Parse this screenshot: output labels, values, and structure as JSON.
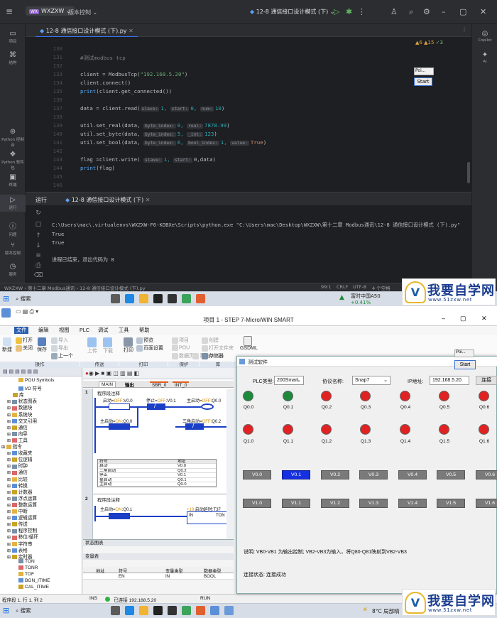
{
  "ide": {
    "project": "WXZXW",
    "project_badge": "WX",
    "version_control": "版本控制",
    "run_config": "12-8 通信接口设计模式 (下)",
    "left_tools": [
      "项目",
      "结构",
      "Python 控制台",
      "Python 软件包",
      "终端",
      "运行",
      "问题",
      "版本控制",
      "服务"
    ],
    "right_tools": [
      "Copilot",
      "AI"
    ],
    "file_tab": "12-8 通信接口设计模式 (下).py",
    "inspections": {
      "warnings": "6",
      "weak": "15",
      "typos": "3"
    },
    "code_lines": [
      {
        "n": "130",
        "parts": []
      },
      {
        "n": "131",
        "parts": [
          {
            "t": "#测试modbus tcp",
            "c": "cm"
          }
        ]
      },
      {
        "n": "132",
        "parts": []
      },
      {
        "n": "133",
        "parts": [
          {
            "t": "client = ModbusTcp(",
            "c": ""
          },
          {
            "t": "\"192.168.5.20\"",
            "c": "str"
          },
          {
            "t": ")",
            "c": ""
          }
        ]
      },
      {
        "n": "134",
        "parts": [
          {
            "t": "client.connect()",
            "c": ""
          }
        ]
      },
      {
        "n": "135",
        "parts": [
          {
            "t": "print",
            "c": "fn"
          },
          {
            "t": "(client.get_connected())",
            "c": ""
          }
        ]
      },
      {
        "n": "136",
        "parts": []
      },
      {
        "n": "137",
        "parts": [
          {
            "t": "data = client.read(",
            "c": ""
          },
          {
            "t": "slave:",
            "c": "hint"
          },
          {
            "t": "1, ",
            "c": "num"
          },
          {
            "t": "start:",
            "c": "hint"
          },
          {
            "t": "0, ",
            "c": "num"
          },
          {
            "t": "num:",
            "c": "hint"
          },
          {
            "t": "10",
            "c": "num"
          },
          {
            "t": ")",
            "c": ""
          }
        ]
      },
      {
        "n": "138",
        "parts": []
      },
      {
        "n": "139",
        "parts": [
          {
            "t": "util.set_real(data, ",
            "c": ""
          },
          {
            "t": "byte_index:",
            "c": "hint"
          },
          {
            "t": "0, ",
            "c": "num"
          },
          {
            "t": "real:",
            "c": "hint"
          },
          {
            "t": "7878.99",
            "c": "num"
          },
          {
            "t": ")",
            "c": ""
          }
        ]
      },
      {
        "n": "140",
        "parts": [
          {
            "t": "util.set_byte(data, ",
            "c": ""
          },
          {
            "t": "byte_index:",
            "c": "hint"
          },
          {
            "t": "5, ",
            "c": "num"
          },
          {
            "t": "_int:",
            "c": "hint"
          },
          {
            "t": "123",
            "c": "num"
          },
          {
            "t": ")",
            "c": ""
          }
        ]
      },
      {
        "n": "141",
        "parts": [
          {
            "t": "util.set_bool(data, ",
            "c": ""
          },
          {
            "t": "byte_index:",
            "c": "hint"
          },
          {
            "t": "6, ",
            "c": "num"
          },
          {
            "t": "bool_index:",
            "c": "hint"
          },
          {
            "t": "1, ",
            "c": "num"
          },
          {
            "t": "value:",
            "c": "hint"
          },
          {
            "t": "True",
            "c": "kw"
          },
          {
            "t": ")",
            "c": ""
          }
        ]
      },
      {
        "n": "142",
        "parts": []
      },
      {
        "n": "143",
        "parts": [
          {
            "t": "flag =client.write( ",
            "c": ""
          },
          {
            "t": "slave:",
            "c": "hint"
          },
          {
            "t": "1, ",
            "c": "num"
          },
          {
            "t": "start:",
            "c": "hint"
          },
          {
            "t": "0,data)",
            "c": ""
          }
        ]
      },
      {
        "n": "144",
        "parts": [
          {
            "t": "print",
            "c": "fn"
          },
          {
            "t": "(flag)",
            "c": ""
          }
        ]
      },
      {
        "n": "145",
        "parts": []
      },
      {
        "n": "146",
        "parts": []
      },
      {
        "n": "147",
        "parts": []
      }
    ],
    "run_label": "运行",
    "run_tab": "12-8 通信接口设计模式 (下)",
    "console": [
      "C:\\Users\\mac\\.virtualenvs\\WXZXW-F6-KOBXe\\Scripts\\python.exe \"C:\\Users\\mac\\Desktop\\WXZXW\\第十二章 Modbus通讯\\12-8 通信接口设计模式 (下).py\"",
      "True",
      "True",
      "",
      "进程已结束，退出代码为 0"
    ],
    "mini_window": "Poi...",
    "start_button": "Start",
    "breadcrumb": [
      "WXZXW",
      "第十二章 Modbus通讯",
      "12-8 通信接口设计模式 (下).py"
    ],
    "status_right": [
      "99:1",
      "CRLF",
      "UTF-8",
      "4 个空格"
    ]
  },
  "taskbar_top": {
    "search": "搜索",
    "tray": "富时中国A50",
    "tray_sub": "+0.41%"
  },
  "watermark": {
    "title": "我要自学网",
    "url": "www.51zxw.net"
  },
  "step7": {
    "title": "项目 1 - STEP 7-Micro/WIN SMART",
    "menus": [
      "文件",
      "编辑",
      "视图",
      "PLC",
      "调试",
      "工具",
      "帮助"
    ],
    "ribbon": {
      "new": "新建",
      "open": "打开",
      "close": "关闭",
      "save": "保存",
      "import": "导入",
      "export": "导出",
      "prev": "上一个",
      "upload": "上传",
      "download": "下载",
      "print": "打印",
      "preview": "预览",
      "page_setup": "页面设置",
      "project": "项目",
      "pou": "POU",
      "data_page": "数据页",
      "system_block": "系统块",
      "create": "创建",
      "open_folder": "打开文件夹",
      "memory_card": "存储器",
      "gsdml": "GSDML",
      "sections": [
        "操作",
        "传送",
        "打印",
        "保护",
        "库"
      ]
    },
    "tree": [
      {
        "t": "POU Symbols",
        "lv": 2
      },
      {
        "t": "I/O 符号",
        "lv": 2
      },
      {
        "t": "库",
        "lv": 1
      },
      {
        "t": "状态图表",
        "lv": 0
      },
      {
        "t": "数据块",
        "lv": 0
      },
      {
        "t": "系统块",
        "lv": 0
      },
      {
        "t": "交叉引用",
        "lv": 0
      },
      {
        "t": "通信",
        "lv": 0
      },
      {
        "t": "向导",
        "lv": 0
      },
      {
        "t": "工具",
        "lv": 0
      },
      {
        "t": "指令",
        "lv": -1
      },
      {
        "t": "收藏夹",
        "lv": 0
      },
      {
        "t": "位逻辑",
        "lv": 0
      },
      {
        "t": "时钟",
        "lv": 0
      },
      {
        "t": "通信",
        "lv": 0
      },
      {
        "t": "比较",
        "lv": 0
      },
      {
        "t": "转换",
        "lv": 0
      },
      {
        "t": "计数器",
        "lv": 0
      },
      {
        "t": "浮点运算",
        "lv": 0
      },
      {
        "t": "整数运算",
        "lv": 0
      },
      {
        "t": "中断",
        "lv": 0
      },
      {
        "t": "逻辑运算",
        "lv": 0
      },
      {
        "t": "传送",
        "lv": 0
      },
      {
        "t": "程序控制",
        "lv": 0
      },
      {
        "t": "移位/循环",
        "lv": 0
      },
      {
        "t": "字符串",
        "lv": 0
      },
      {
        "t": "表格",
        "lv": 0
      },
      {
        "t": "定时器",
        "lv": 0
      },
      {
        "t": "TON",
        "lv": 2
      },
      {
        "t": "TONR",
        "lv": 2
      },
      {
        "t": "TOF",
        "lv": 2
      },
      {
        "t": "BGN_ITIME",
        "lv": 2
      },
      {
        "t": "CAL_ITIME",
        "lv": 2
      }
    ],
    "prog_tabs": [
      "MAIN",
      "SBR_0",
      "INT_0"
    ],
    "seg1_title": "程序段注释",
    "seg1_num": "1",
    "seg2_num": "2",
    "seg2_title": "程序段注释",
    "rung": {
      "start": "启动",
      "start_state": "OFF",
      "start_addr": "V0.0",
      "stop": "停止",
      "stop_state": "OFF",
      "stop_addr": "V0.1",
      "main_start": "主启动",
      "main_start_state": "ON",
      "main_start_addr": "Q0.0",
      "tri_start": "三角启动",
      "tri_start_state": "OFF",
      "tri_start_addr": "Q0.2",
      "coil_out": "主启动",
      "coil_state": "OFF",
      "coil_addr": "Q0.0",
      "seg2_contact": "主启动",
      "seg2_state": "ON",
      "seg2_addr": "Q0.1",
      "timer_pre": "+19",
      "timer_name": "启动延时",
      "timer_addr": "T37",
      "timer_in": "IN",
      "timer_type": "TON"
    },
    "symbol_table": {
      "headers": [
        "符号",
        "地址"
      ],
      "rows": [
        [
          "启动",
          "V0.0"
        ],
        [
          "三角启动",
          "Q0.2"
        ],
        [
          "停止",
          "V0.1"
        ],
        [
          "星启动",
          "Q0.1"
        ],
        [
          "主启动",
          "Q0.0"
        ]
      ]
    },
    "state_table": "状态图表",
    "var_table": "变量表",
    "var_headers": [
      "地址",
      "符号",
      "变量类型",
      "数据类型",
      "注释"
    ],
    "var_row": [
      "",
      "EN",
      "IN",
      "BOOL",
      ""
    ],
    "status": {
      "pos": "程序段 1, 行 1, 列 2",
      "ins": "INS",
      "conn": "已连接 192.168.5.20",
      "run": "RUN"
    }
  },
  "taskbar_bottom": {
    "search": "搜索",
    "weather": "8°C 局部晴"
  },
  "test_app": {
    "title": "测试软件",
    "plc_type_label": "PLC类型:",
    "plc_type": "200Smart",
    "protocol_label": "协议名称:",
    "protocol": "Snap7",
    "ip_label": "IP地址:",
    "ip": "192.168.5.20",
    "connect": "连接",
    "q0": [
      {
        "l": "Q0.0",
        "on": true
      },
      {
        "l": "Q0.1",
        "on": true
      },
      {
        "l": "Q0.2",
        "on": false
      },
      {
        "l": "Q0.3",
        "on": false
      },
      {
        "l": "Q0.4",
        "on": false
      },
      {
        "l": "Q0.5",
        "on": false
      },
      {
        "l": "Q0.6",
        "on": false
      }
    ],
    "q1": [
      "Q1.0",
      "Q1.1",
      "Q1.2",
      "Q1.3",
      "Q1.4",
      "Q1.5",
      "Q1.6"
    ],
    "v0": [
      "V0.0",
      "V0.1",
      "V0.2",
      "V0.3",
      "V0.4",
      "V0.5",
      "V0.6"
    ],
    "v1": [
      "V1.0",
      "V1.1",
      "V1.2",
      "V1.3",
      "V1.4",
      "V1.5",
      "V1.6"
    ],
    "note": "说明: VB0-VB1 为输出控制; VB2-VB3为输入，将Q80-Q81映射到VB2-VB3",
    "status_label": "连接状态:",
    "status_value": "连接成功",
    "mini_window": "Poi...",
    "start_button": "Start"
  },
  "colors": {
    "led_on": "#1c8a3a",
    "led_off": "#e02222",
    "ladder": "#1a3fc6",
    "selected_btn": "#1530e0"
  }
}
